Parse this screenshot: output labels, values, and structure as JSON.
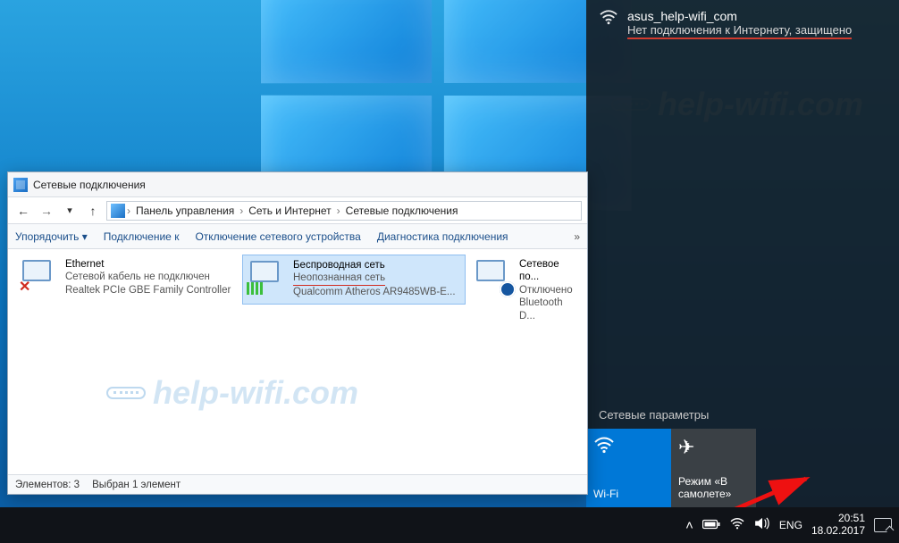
{
  "watermark": "help-wifi.com",
  "flyout": {
    "ssid": "asus_help-wifi_com",
    "status_line": "Нет подключения к Интернету, защищено",
    "section_label": "Сетевые параметры",
    "tiles": {
      "wifi": "Wi-Fi",
      "airplane": "Режим «В самолете»"
    }
  },
  "window": {
    "title": "Сетевые подключения",
    "breadcrumbs": {
      "root": "Панель управления",
      "mid": "Сеть и Интернет",
      "leaf": "Сетевые подключения"
    },
    "commands": {
      "organize": "Упорядочить ▾",
      "connect": "Подключение к",
      "disable": "Отключение сетевого устройства",
      "diagnose": "Диагностика подключения",
      "more": "»"
    },
    "items": [
      {
        "name": "Ethernet",
        "line2": "Сетевой кабель не подключен",
        "line3": "Realtek PCIe GBE Family Controller"
      },
      {
        "name": "Беспроводная сеть",
        "line2": "Неопознанная сеть",
        "line3": "Qualcomm Atheros AR9485WB-E..."
      },
      {
        "name": "Сетевое по...",
        "line2": "Отключено",
        "line3": "Bluetooth D..."
      }
    ],
    "status": {
      "elements": "Элементов: 3",
      "selected": "Выбран 1 элемент"
    }
  },
  "taskbar": {
    "lang": "ENG",
    "time": "20:51",
    "date": "18.02.2017"
  }
}
